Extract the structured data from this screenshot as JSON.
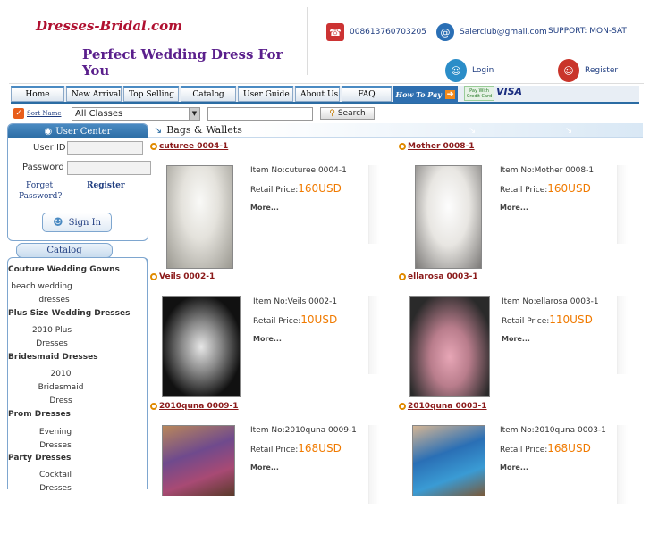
{
  "header": {
    "logo": "Dresses-Bridal.com",
    "tagline": "Perfect Wedding Dress For You",
    "phone": "008613760703205",
    "email": "Salerclub@gmail.com",
    "support": "SUPPORT: MON-SAT",
    "login_label": "Login",
    "register_label": "Register"
  },
  "nav": {
    "items": [
      {
        "label": "Home"
      },
      {
        "label": "New Arrival"
      },
      {
        "label": "Top Selling"
      },
      {
        "label": "Catalog"
      },
      {
        "label": "User Guide"
      },
      {
        "label": "About Us"
      },
      {
        "label": "FAQ"
      }
    ],
    "how_to_pay": "How To Pay",
    "pay_with": "Pay With Credit Card",
    "visa": "VISA"
  },
  "search": {
    "sort_label": "Sort Name",
    "class_value": "All Classes",
    "keyword_value": "",
    "button_label": "Search"
  },
  "user_center": {
    "title": "User Center",
    "user_id_label": "User ID :",
    "password_label": "Password :",
    "forgot_label_1": "Forget",
    "forgot_label_2": "Password?",
    "register_label": "Register",
    "sign_in_label": "Sign In"
  },
  "catalog": {
    "title": "Catalog",
    "groups": [
      {
        "heading": "Couture Wedding Gowns",
        "sub": [
          "beach wedding",
          "dresses"
        ]
      },
      {
        "heading": "Plus Size Wedding Dresses",
        "sub": [
          "2010 Plus",
          "Dresses"
        ]
      },
      {
        "heading": "Bridesmaid Dresses",
        "sub": [
          "2010",
          "Bridesmaid",
          "Dress"
        ]
      },
      {
        "heading": "Prom Dresses",
        "sub": [
          "Evening",
          "Dresses"
        ]
      },
      {
        "heading": "Party Dresses",
        "sub": [
          "Cocktail",
          "Dresses"
        ]
      }
    ]
  },
  "section": {
    "title": "Bags & Wallets"
  },
  "products": [
    {
      "title": "cuturee 0004-1",
      "item": "Item No:cuturee 0004-1",
      "price_label": "Retail Price:",
      "price": "160USD",
      "more": "More..."
    },
    {
      "title": "Mother 0008-1",
      "item": "Item No:Mother 0008-1",
      "price_label": "Retail Price:",
      "price": "160USD",
      "more": "More..."
    },
    {
      "title": "Veils 0002-1",
      "item": "Item No:Veils 0002-1",
      "price_label": "Retail Price:",
      "price": "10USD",
      "more": "More..."
    },
    {
      "title": "ellarosa 0003-1",
      "item": "Item No:ellarosa 0003-1",
      "price_label": "Retail Price:",
      "price": "110USD",
      "more": "More..."
    },
    {
      "title": "2010quna 0009-1",
      "item": "Item No:2010quna 0009-1",
      "price_label": "Retail Price:",
      "price": "168USD",
      "more": "More..."
    },
    {
      "title": "2010quna 0003-1",
      "item": "Item No:2010quna 0003-1",
      "price_label": "Retail Price:",
      "price": "168USD",
      "more": "More..."
    }
  ],
  "colors": {
    "accent_blue": "#2b6ca3",
    "price_orange": "#f07a00",
    "title_red": "#8b1a1a",
    "logo_red": "#b01030",
    "tagline_purple": "#5a1f8c"
  }
}
